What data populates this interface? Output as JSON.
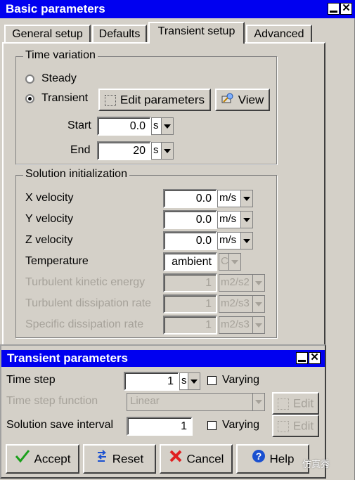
{
  "main_window": {
    "title": "Basic parameters",
    "tabs": [
      "General setup",
      "Defaults",
      "Transient setup",
      "Advanced"
    ],
    "active_tab": "Transient setup",
    "time_variation": {
      "legend": "Time variation",
      "steady_label": "Steady",
      "transient_label": "Transient",
      "selected": "Transient",
      "edit_parameters_label": "Edit parameters",
      "view_label": "View",
      "start_label": "Start",
      "start_value": "0.0",
      "start_unit": "s",
      "end_label": "End",
      "end_value": "20",
      "end_unit": "s"
    },
    "solution_init": {
      "legend": "Solution initialization",
      "rows": [
        {
          "label": "X velocity",
          "value": "0.0",
          "unit": "m/s",
          "enabled": true
        },
        {
          "label": "Y velocity",
          "value": "0.0",
          "unit": "m/s",
          "enabled": true
        },
        {
          "label": "Z velocity",
          "value": "0.0",
          "unit": "m/s",
          "enabled": true
        },
        {
          "label": "Temperature",
          "value": "ambient",
          "unit": "C",
          "enabled": true
        },
        {
          "label": "Turbulent kinetic energy",
          "value": "1",
          "unit": "m2/s2",
          "enabled": false
        },
        {
          "label": "Turbulent dissipation rate",
          "value": "1",
          "unit": "m2/s3",
          "enabled": false
        },
        {
          "label": "Specific dissipation rate",
          "value": "1",
          "unit": "m2/s3",
          "enabled": false
        }
      ]
    }
  },
  "dialog": {
    "title": "Transient parameters",
    "time_step_label": "Time step",
    "time_step_value": "1",
    "time_step_unit": "s",
    "varying_label": "Varying",
    "time_step_function_label": "Time step function",
    "time_step_function_value": "Linear",
    "edit_label": "Edit",
    "solution_save_interval_label": "Solution save interval",
    "solution_save_interval_value": "1",
    "buttons": {
      "accept": "Accept",
      "reset": "Reset",
      "cancel": "Cancel",
      "help": "Help"
    }
  },
  "watermark": "仿真秀",
  "colors": {
    "titlebar": "#0000f0",
    "face": "#d4d0c8",
    "disabled_text": "#a6a29a",
    "accept_check": "#1aa01a",
    "cancel_x": "#e02020",
    "help_blue": "#1a50d0"
  },
  "icons": [
    "minimize-icon",
    "close-icon",
    "edit-parameters-icon",
    "view-icon",
    "dropdown-arrow-icon",
    "accept-check-icon",
    "reset-icon",
    "cancel-x-icon",
    "help-icon"
  ]
}
